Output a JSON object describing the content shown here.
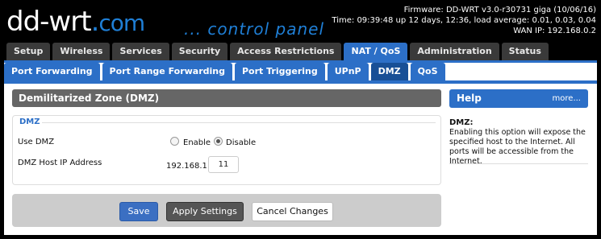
{
  "header": {
    "logo_main": "dd-wrt",
    "logo_dot": ".",
    "logo_com": "com",
    "tagline": "... control panel",
    "firmware": "Firmware: DD-WRT v3.0-r30731 giga (10/06/16)",
    "time": "Time: 09:39:48 up 12 days, 12:36, load average: 0.01, 0.03, 0.04",
    "wan_ip": "WAN IP: 192.168.0.2"
  },
  "main_tabs": [
    "Setup",
    "Wireless",
    "Services",
    "Security",
    "Access Restrictions",
    "NAT / QoS",
    "Administration",
    "Status"
  ],
  "sub_tabs": [
    "Port Forwarding",
    "Port Range Forwarding",
    "Port Triggering",
    "UPnP",
    "DMZ",
    "QoS"
  ],
  "section_title": "Demilitarized Zone (DMZ)",
  "dmz": {
    "legend": "DMZ",
    "use_dmz_label": "Use DMZ",
    "enable_label": "Enable",
    "disable_label": "Disable",
    "host_ip_label": "DMZ Host IP Address",
    "ip_prefix": "192.168.1.",
    "ip_value": "11"
  },
  "buttons": {
    "save": "Save",
    "apply": "Apply Settings",
    "cancel": "Cancel Changes"
  },
  "help": {
    "title": "Help",
    "more": "more...",
    "item_title": "DMZ:",
    "item_text": "Enabling this option will expose the specified host to the Internet. All ports will be accessible from the Internet."
  },
  "colors": {
    "accent": "#2c6fc7",
    "background": "#000000"
  }
}
